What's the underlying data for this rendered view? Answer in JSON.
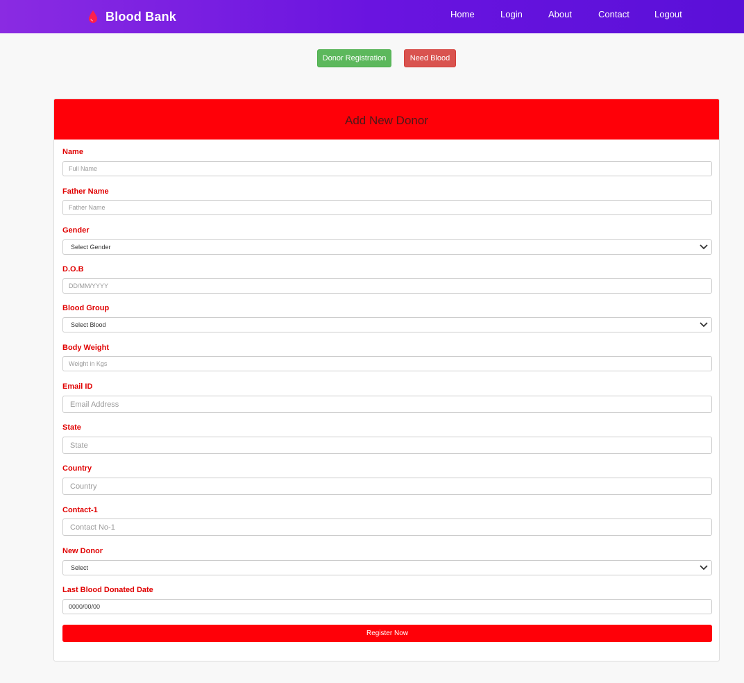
{
  "nav": {
    "brand": "Blood Bank",
    "links": [
      "Home",
      "Login",
      "About",
      "Contact",
      "Logout"
    ],
    "icon": "blood-drop-icon"
  },
  "actions": {
    "donor_registration": "Donor Registration",
    "need_blood": "Need Blood"
  },
  "form": {
    "title": "Add New Donor",
    "fields": {
      "name": {
        "label": "Name",
        "placeholder": "Full Name"
      },
      "father_name": {
        "label": "Father Name",
        "placeholder": "Father Name"
      },
      "gender": {
        "label": "Gender",
        "selected": "Select Gender"
      },
      "dob": {
        "label": "D.O.B",
        "placeholder": "DD/MM/YYYY"
      },
      "blood_group": {
        "label": "Blood Group",
        "selected": "Select Blood"
      },
      "body_weight": {
        "label": "Body Weight",
        "placeholder": "Weight in Kgs"
      },
      "email": {
        "label": "Email ID",
        "placeholder": "Email Address"
      },
      "state": {
        "label": "State",
        "placeholder": "State"
      },
      "country": {
        "label": "Country",
        "placeholder": "Country"
      },
      "contact1": {
        "label": "Contact-1",
        "placeholder": "Contact No-1"
      },
      "new_donor": {
        "label": "New Donor",
        "selected": "Select"
      },
      "last_donated": {
        "label": "Last Blood Donated Date",
        "value": "0000/00/00"
      }
    },
    "submit_label": "Register Now"
  },
  "colors": {
    "nav_gradient_start": "#8a2be2",
    "nav_gradient_end": "#5a10d8",
    "header_red": "#ff0008",
    "label_red": "#e00000",
    "success_green": "#5cb85c",
    "danger_red": "#d9534f"
  }
}
